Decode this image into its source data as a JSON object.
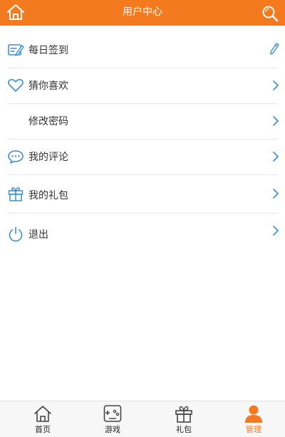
{
  "header": {
    "title": "用户中心",
    "background_color": "#f47a20",
    "left_icon": "home-icon",
    "right_icon": "search-icon"
  },
  "menu": {
    "items": [
      {
        "label": "每日签到",
        "icon": "checkin-icon",
        "trailing_icon": "pencil-icon"
      },
      {
        "label": "猜你喜欢",
        "icon": "heart-icon",
        "trailing_icon": "chevron-right-icon"
      },
      {
        "label": "修改密码",
        "icon": "",
        "trailing_icon": "chevron-right-icon"
      },
      {
        "label": "我的评论",
        "icon": "comment-icon",
        "trailing_icon": "chevron-right-icon"
      },
      {
        "label": "我的礼包",
        "icon": "gift-icon",
        "trailing_icon": "chevron-right-icon"
      },
      {
        "label": "退出",
        "icon": "power-icon",
        "trailing_icon": "chevron-right-icon"
      }
    ]
  },
  "tabbar": {
    "active_color": "#f47a20",
    "tabs": [
      {
        "label": "首页",
        "icon": "home-icon",
        "active": false
      },
      {
        "label": "游戏",
        "icon": "gamepad-icon",
        "active": false
      },
      {
        "label": "礼包",
        "icon": "gift-icon",
        "active": false
      },
      {
        "label": "管理",
        "icon": "user-icon",
        "active": true
      }
    ]
  }
}
